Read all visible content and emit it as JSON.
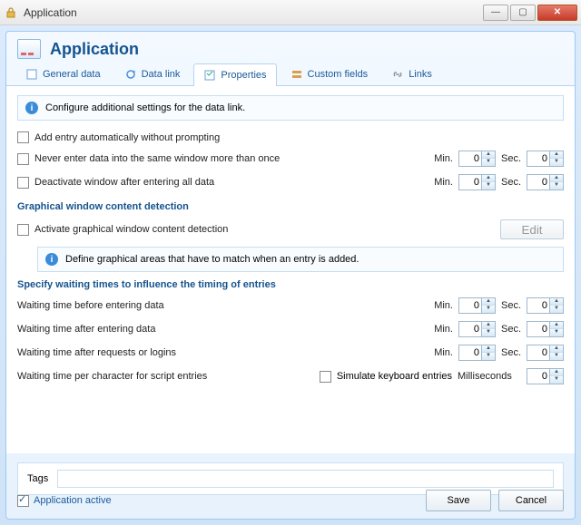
{
  "window": {
    "title": "Application"
  },
  "header": {
    "title": "Application"
  },
  "tabs": {
    "general": "General data",
    "datalink": "Data link",
    "properties": "Properties",
    "customfields": "Custom fields",
    "links": "Links"
  },
  "info": {
    "main": "Configure additional settings for the data link.",
    "graphical": "Define graphical areas that have to match when an entry is added."
  },
  "checks": {
    "auto": "Add entry automatically without prompting",
    "never": "Never enter data into the same window more than once",
    "deact": "Deactivate window after entering all data",
    "activate_graph": "Activate graphical window content detection",
    "simulate": "Simulate keyboard entries"
  },
  "sections": {
    "graphical": "Graphical window content detection",
    "waiting": "Specify waiting times to influence the timing of entries"
  },
  "labels": {
    "min": "Min.",
    "sec": "Sec.",
    "ms": "Milliseconds",
    "edit": "Edit",
    "wait_before": "Waiting time before entering data",
    "wait_after": "Waiting time after entering data",
    "wait_req": "Waiting time after requests or logins",
    "wait_char": "Waiting time per character for script entries",
    "tags": "Tags"
  },
  "values": {
    "never_min": "0",
    "never_sec": "0",
    "deact_min": "0",
    "deact_sec": "0",
    "before_min": "0",
    "before_sec": "0",
    "after_min": "0",
    "after_sec": "0",
    "req_min": "0",
    "req_sec": "0",
    "char_ms": "0",
    "tags": ""
  },
  "footer": {
    "active": "Application active",
    "save": "Save",
    "cancel": "Cancel"
  }
}
